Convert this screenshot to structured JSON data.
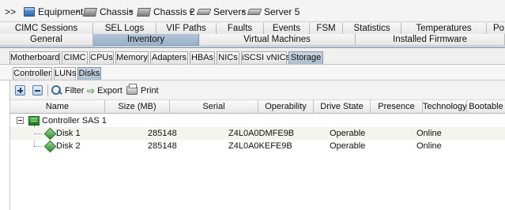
{
  "breadcrumb": {
    "prefix": ">>",
    "items": [
      {
        "label": "Equipment",
        "icon": "equipment-icon"
      },
      {
        "label": "Chassis",
        "icon": "chassis-icon"
      },
      {
        "label": "Chassis 2",
        "icon": "chassis-icon"
      },
      {
        "label": "Servers",
        "icon": "servers-icon"
      },
      {
        "label": "Server 5",
        "icon": "server-icon"
      }
    ],
    "separator": "▸"
  },
  "tab_row_1": [
    "CIMC Sessions",
    "SEL Logs",
    "VIF Paths",
    "Faults",
    "Events",
    "FSM",
    "Statistics",
    "Temperatures",
    "Po"
  ],
  "tab_row_2": [
    {
      "label": "General",
      "active": false
    },
    {
      "label": "Inventory",
      "active": true
    },
    {
      "label": "Virtual Machines",
      "active": false
    },
    {
      "label": "Installed Firmware",
      "active": false
    }
  ],
  "inventory_tabs": [
    {
      "label": "Motherboard",
      "active": false
    },
    {
      "label": "CIMC",
      "active": false
    },
    {
      "label": "CPUs",
      "active": false
    },
    {
      "label": "Memory",
      "active": false
    },
    {
      "label": "Adapters",
      "active": false
    },
    {
      "label": "HBAs",
      "active": false
    },
    {
      "label": "NICs",
      "active": false
    },
    {
      "label": "iSCSI vNICs",
      "active": false
    },
    {
      "label": "Storage",
      "active": true
    }
  ],
  "storage_tabs": [
    {
      "label": "Controller",
      "active": false
    },
    {
      "label": "LUNs",
      "active": false
    },
    {
      "label": "Disks",
      "active": true
    }
  ],
  "toolbar": {
    "filter_label": "Filter",
    "export_label": "Export",
    "print_label": "Print"
  },
  "table": {
    "columns": [
      "Name",
      "Size (MB)",
      "Serial",
      "Operability",
      "Drive State",
      "Presence",
      "Technology",
      "Bootable"
    ],
    "controller": {
      "name": "Controller SAS 1",
      "icon": "controller-icon"
    },
    "rows": [
      {
        "name": "Disk 1",
        "size": "285148",
        "serial": "Z4L0A0DMFE9B",
        "operability": "Operable",
        "drive_state": "",
        "presence": "Online",
        "technology": "",
        "bootable": "",
        "icon": "disk-icon"
      },
      {
        "name": "Disk 2",
        "size": "285148",
        "serial": "Z4L0A0KEFE9B",
        "operability": "Operable",
        "drive_state": "",
        "presence": "Online",
        "technology": "",
        "bootable": "",
        "icon": "disk-icon"
      }
    ]
  },
  "colors": {
    "active_tab": "#a9bccf",
    "status_icon": "#2b8e2b"
  }
}
